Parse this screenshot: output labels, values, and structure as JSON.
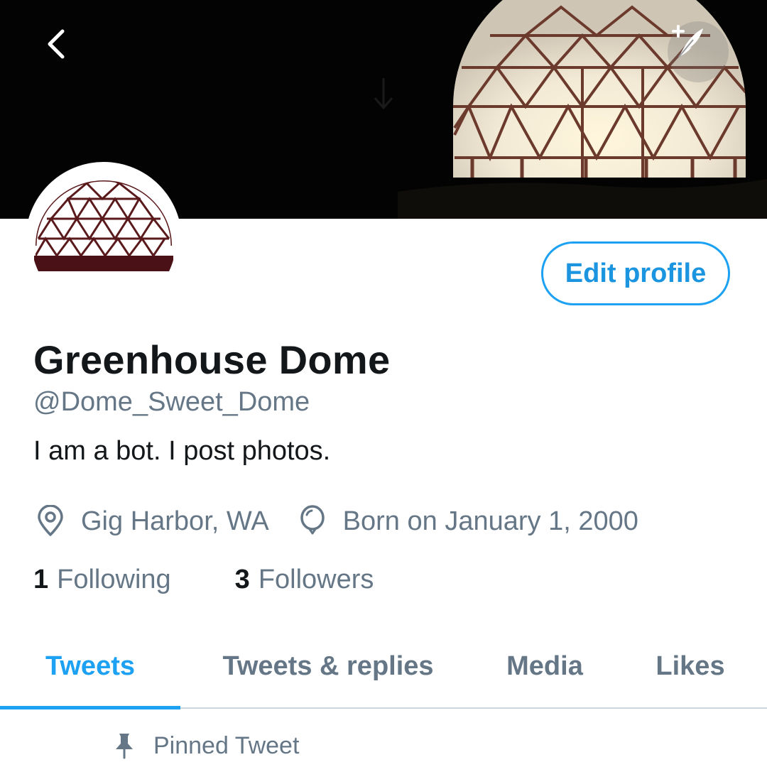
{
  "profile": {
    "name": "Greenhouse Dome",
    "handle": "@Dome_Sweet_Dome",
    "bio": "I am a bot. I post photos.",
    "location": "Gig Harbor, WA",
    "birthday": "Born on January 1, 2000",
    "following_count": "1",
    "following_label": "Following",
    "followers_count": "3",
    "followers_label": "Followers"
  },
  "actions": {
    "edit_profile": "Edit profile"
  },
  "tabs": [
    {
      "label": "Tweets",
      "active": true
    },
    {
      "label": "Tweets & replies",
      "active": false
    },
    {
      "label": "Media",
      "active": false
    },
    {
      "label": "Likes",
      "active": false
    }
  ],
  "pinned": {
    "label": "Pinned Tweet"
  },
  "icons": {
    "back": "chevron-left-icon",
    "compose": "compose-feather-icon",
    "location": "location-pin-icon",
    "birthday": "balloon-icon",
    "pin": "pushpin-icon"
  },
  "colors": {
    "accent": "#1da1f2",
    "secondary_text": "#657786",
    "primary_text": "#14171a",
    "avatar_dome": "#5a1a1c"
  }
}
